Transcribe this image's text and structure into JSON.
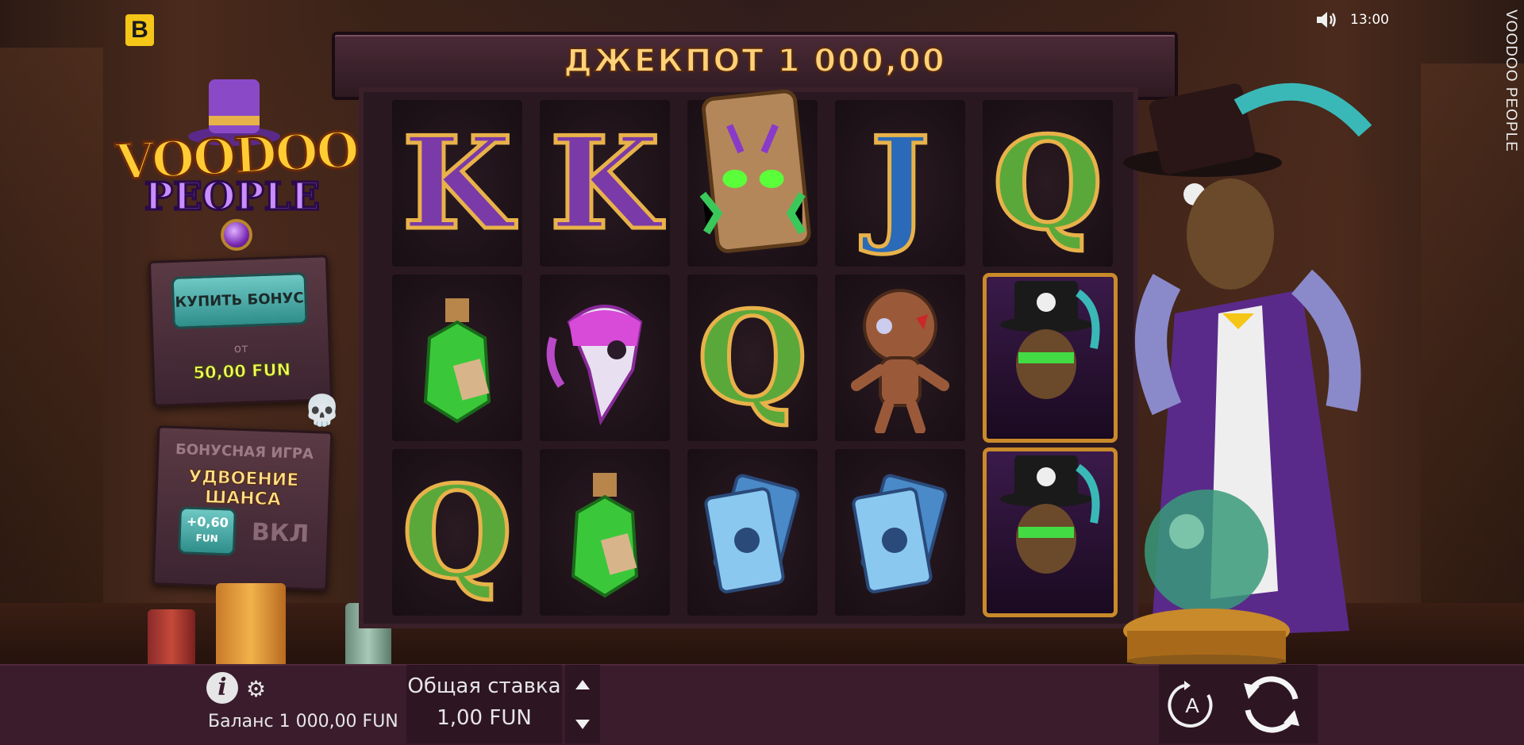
{
  "brand": {
    "logo_letter": "B"
  },
  "status": {
    "time": "13:00",
    "sound_icon": "speaker-icon"
  },
  "game": {
    "vertical_title": "VOODOO PEOPLE",
    "logo_line1": "VOODOO",
    "logo_line2": "PEOPLE",
    "jackpot": "ДЖЕКПОТ 1 000,00"
  },
  "buy_bonus": {
    "label": "КУПИТЬ БОНУС",
    "from_label": "от",
    "price": "50,00 FUN"
  },
  "bonus_game": {
    "title": "БОНУСНАЯ ИГРА",
    "name": "УДВОЕНИЕ ШАНСА",
    "cost_line1": "+0,60",
    "cost_line2": "FUN",
    "toggle_label": "ВКЛ"
  },
  "reels": [
    [
      "K",
      "potion",
      "Q"
    ],
    [
      "K",
      "bird-skull-mask",
      "potion"
    ],
    [
      "tiki-mask",
      "Q",
      "blue-cards"
    ],
    [
      "J",
      "voodoo-doll",
      "blue-cards"
    ],
    [
      "Q",
      "voodoo-man",
      "voodoo-man"
    ]
  ],
  "bottom": {
    "info_label": "i",
    "balance": "Баланс 1 000,00 FUN",
    "bet_title": "Общая ставка",
    "bet_value": "1,00 FUN",
    "auto_label": "A"
  },
  "colors": {
    "bar": "#3a1c2c",
    "accent_gold": "#e8b24a",
    "teal": "#6ec8c4"
  }
}
